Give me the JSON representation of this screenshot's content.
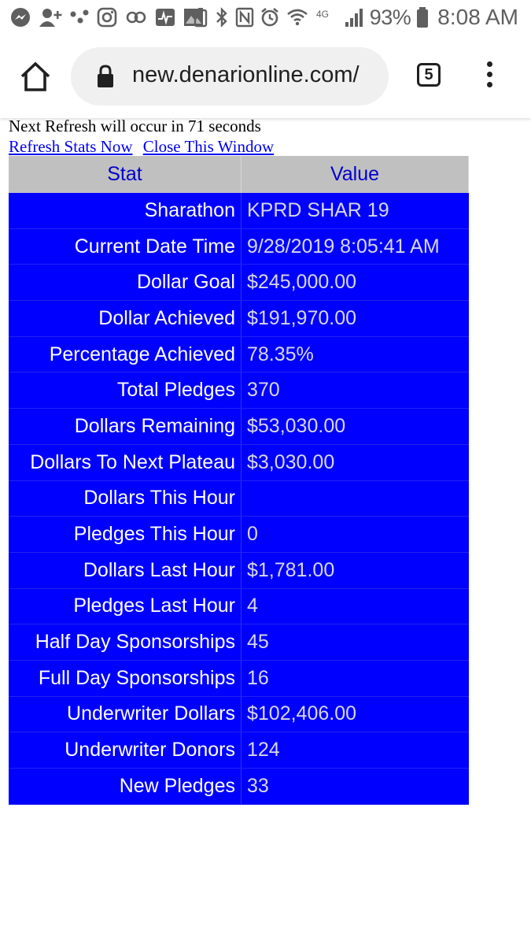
{
  "status_bar": {
    "battery_percent": "93%",
    "time": "8:08 AM",
    "network_label": "4G",
    "left_icons": [
      "messenger-icon",
      "add-contact-icon",
      "dots-icon",
      "instagram-icon",
      "link-icon",
      "pulse-icon",
      "photo-icon"
    ],
    "right_icons": [
      "battery-saver-icon",
      "bluetooth-icon",
      "nfc-icon",
      "alarm-icon",
      "wifi-icon",
      "signal-icon",
      "battery-icon"
    ]
  },
  "browser": {
    "url": "new.denarionline.com/",
    "tab_count": "5"
  },
  "page": {
    "refresh_note": "Next Refresh will occur in 71 seconds",
    "refresh_link": "Refresh Stats Now",
    "close_link": "Close This Window"
  },
  "table": {
    "headers": {
      "stat": "Stat",
      "value": "Value"
    },
    "rows": [
      {
        "stat": "Sharathon",
        "value": "KPRD SHAR 19"
      },
      {
        "stat": "Current Date Time",
        "value": "9/28/2019 8:05:41 AM"
      },
      {
        "stat": "Dollar Goal",
        "value": "$245,000.00"
      },
      {
        "stat": "Dollar Achieved",
        "value": "$191,970.00"
      },
      {
        "stat": "Percentage Achieved",
        "value": "78.35%"
      },
      {
        "stat": "Total Pledges",
        "value": "370"
      },
      {
        "stat": "Dollars Remaining",
        "value": "$53,030.00"
      },
      {
        "stat": "Dollars To Next Plateau",
        "value": "$3,030.00"
      },
      {
        "stat": "Dollars This Hour",
        "value": ""
      },
      {
        "stat": "Pledges This Hour",
        "value": "0"
      },
      {
        "stat": "Dollars Last Hour",
        "value": "$1,781.00"
      },
      {
        "stat": "Pledges Last Hour",
        "value": "4"
      },
      {
        "stat": "Half Day Sponsorships",
        "value": "45"
      },
      {
        "stat": "Full Day Sponsorships",
        "value": "16"
      },
      {
        "stat": "Underwriter Dollars",
        "value": "$102,406.00"
      },
      {
        "stat": "Underwriter Donors",
        "value": "124"
      },
      {
        "stat": "New Pledges",
        "value": "33"
      }
    ]
  },
  "colors": {
    "table_bg": "#0000ff",
    "header_bg": "#c0c0c0",
    "header_text": "#0000cc",
    "link": "#0000ee"
  }
}
